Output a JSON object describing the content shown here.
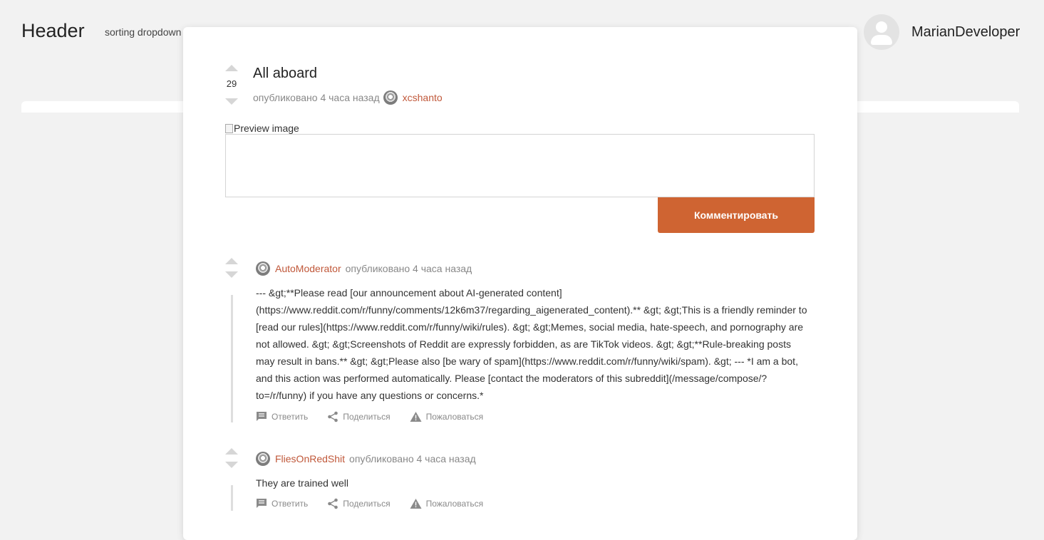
{
  "header": {
    "title": "Header",
    "sorting_dropdown": "sorting dropdown",
    "username": "MarianDeveloper"
  },
  "post": {
    "score": "29",
    "title": "All aboard",
    "published": "опубликовано 4 часа назад",
    "author": "xcshanto",
    "preview_alt": "Preview image",
    "comment_button": "Комментировать"
  },
  "comments": [
    {
      "author": "AutoModerator",
      "published": "опубликовано 4 часа назад",
      "text": "--- &gt;**Please read [our announcement about AI-generated content](https://www.reddit.com/r/funny/comments/12k6m37/regarding_aigenerated_content).** &gt; &gt;This is a friendly reminder to [read our rules](https://www.reddit.com/r/funny/wiki/rules). &gt; &gt;Memes, social media, hate-speech, and pornography are not allowed. &gt; &gt;Screenshots of Reddit are expressly forbidden, as are TikTok videos. &gt; &gt;**Rule-breaking posts may result in bans.** &gt; &gt;Please also [be wary of spam](https://www.reddit.com/r/funny/wiki/spam). &gt; --- *I am a bot, and this action was performed automatically. Please [contact the moderators of this subreddit](/message/compose/?to=/r/funny) if you have any questions or concerns.*"
    },
    {
      "author": "FliesOnRedShit",
      "published": "опубликовано 4 часа назад",
      "text": "They are trained well"
    }
  ],
  "actions": {
    "reply": "Ответить",
    "share": "Поделиться",
    "report": "Пожаловаться"
  },
  "colors": {
    "accent": "#cf6432",
    "author_link": "#c0583a",
    "background": "#f2f2f2"
  }
}
